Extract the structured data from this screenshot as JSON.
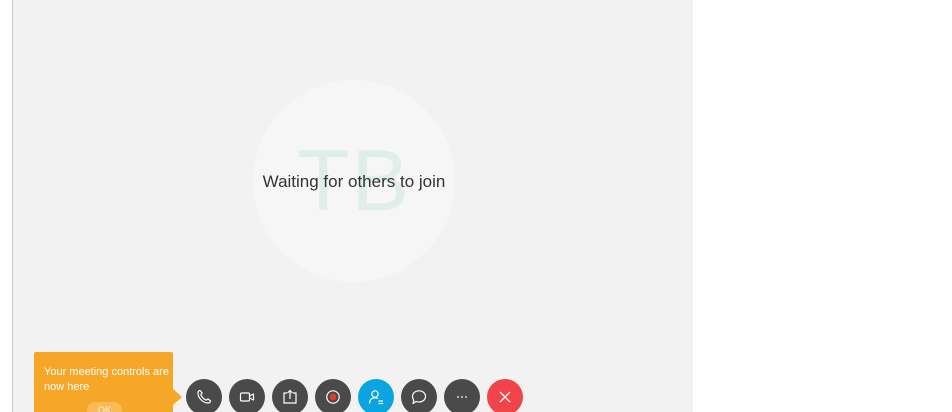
{
  "meeting": {
    "avatar_initials": "TB",
    "status_text": "Waiting for others to join"
  },
  "tooltip": {
    "message": "Your meeting controls are now here",
    "ok_label": "OK"
  },
  "controls": [
    {
      "name": "audio",
      "icon": "phone-icon"
    },
    {
      "name": "video",
      "icon": "video-camera-icon"
    },
    {
      "name": "share",
      "icon": "share-screen-icon"
    },
    {
      "name": "record",
      "icon": "record-icon"
    },
    {
      "name": "participants",
      "icon": "participants-icon"
    },
    {
      "name": "chat",
      "icon": "chat-bubble-icon"
    },
    {
      "name": "more",
      "icon": "more-options-icon"
    },
    {
      "name": "leave",
      "icon": "close-icon"
    }
  ],
  "colors": {
    "control_dark": "#4a4a4a",
    "participants_active": "#0aa5e0",
    "leave_red": "#f0434a",
    "tooltip_orange": "#f7a727",
    "record_dot": "#e8392f"
  }
}
